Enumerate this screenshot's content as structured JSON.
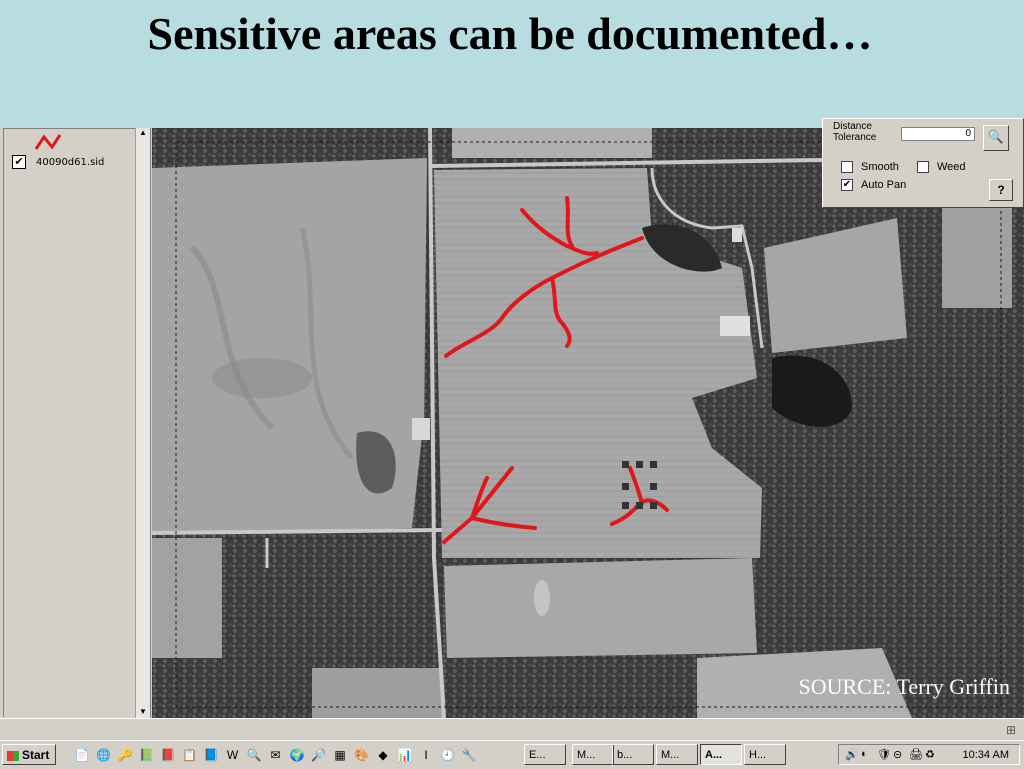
{
  "slide": {
    "title": "Sensitive areas can be documented…",
    "source": "SOURCE: Terry Griffin"
  },
  "toc": {
    "theme_label": "40090d61.sid",
    "theme_checked": "✔",
    "up_arrow": "▲",
    "down_arrow": "▼"
  },
  "panel": {
    "tolerance_label": "Distance\nTolerance",
    "tolerance_value": "0",
    "smooth_label": "Smooth",
    "weed_label": "Weed",
    "autopan_label": "Auto Pan",
    "autopan_checked": "✔",
    "magnify_glyph": "🔍",
    "help_glyph": "?"
  },
  "statusbar": {
    "grip": "⊞"
  },
  "taskbar": {
    "start_label": "Start",
    "quick_launch": [
      "📄",
      "🌐",
      "🔑",
      "📗",
      "📕",
      "📋",
      "📘",
      "W",
      "🔍",
      "✉",
      "🌍",
      "🔎",
      "▦",
      "🎨",
      "◆",
      "📊",
      "I",
      "🕘",
      "🔧"
    ],
    "tasks": [
      "E...",
      "M...",
      "b...",
      "M...",
      "A...",
      "H..."
    ],
    "active_task": "A...",
    "tray_icons": [
      "🔊",
      "◐",
      "🛡",
      "⊝",
      "🖨",
      "♻"
    ],
    "clock": "10:34 AM"
  },
  "colors": {
    "title_band": "#b7dde1",
    "annotation": "#e0161b",
    "map_bg": "#9c9c9c"
  }
}
